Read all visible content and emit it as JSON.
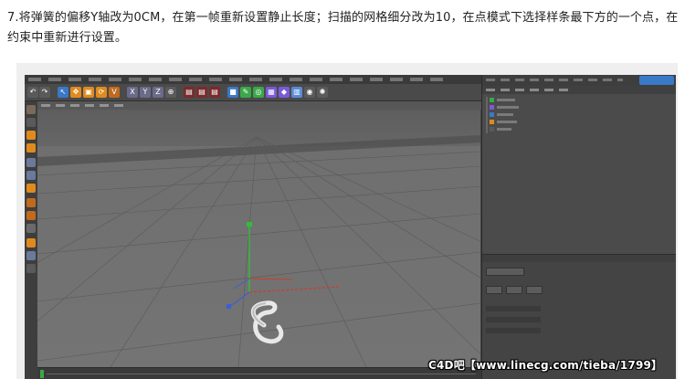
{
  "instruction": {
    "text": "7.将弹簧的偏移Y轴改为0CM，在第一帧重新设置静止长度；扫描的网格细分改为10，在点模式下选择样条最下方的一个点，在约束中重新进行设置。"
  },
  "watermark": {
    "text": "C4D吧【www.linecg.com/tieba/1799】"
  },
  "colors": {
    "axis_x": "#d23a2a",
    "axis_y": "#2fbf3a",
    "axis_z": "#3a5fd8",
    "viewport_bg": "#6e6e6e",
    "accent_orange": "#e08a1e"
  },
  "icons": {
    "undo": "undo-icon",
    "move": "move-icon",
    "axis_lock": "axis-lock-icon",
    "render": "render-icon",
    "spline": "spline-tool-icon",
    "object": "object-icon"
  }
}
